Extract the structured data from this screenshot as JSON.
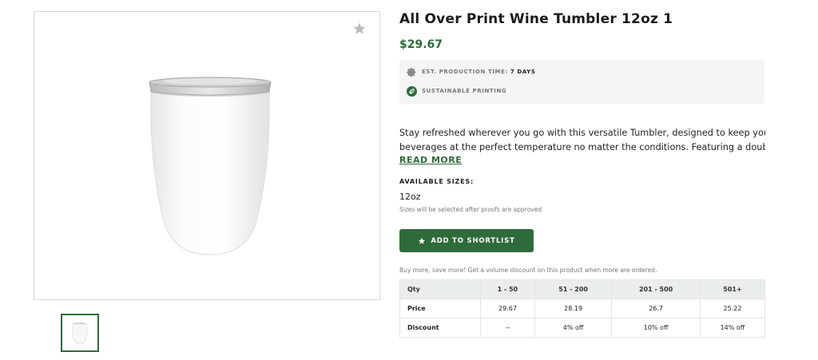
{
  "product": {
    "title": "All Over Print Wine Tumbler 12oz 1",
    "price": "$29.67",
    "specs": {
      "production_label": "EST. PRODUCTION TIME:",
      "production_value": "7 DAYS",
      "production_icon": "gear-icon",
      "sustainable_label": "SUSTAINABLE PRINTING",
      "sustainable_icon": "leaf-icon"
    },
    "description_line1": "Stay refreshed wherever you go with this versatile Tumbler, designed to keep your",
    "description_line2": "beverages at the perfect temperature no matter the conditions. Featuring a double-…",
    "read_more": "READ MORE"
  },
  "sizes": {
    "label": "AVAILABLE SIZES:",
    "value": "12oz",
    "note": "Sizes will be selected after proofs are approved"
  },
  "actions": {
    "shortlist_label": "ADD TO SHORTLIST",
    "shortlist_icon": "star-icon"
  },
  "gallery": {
    "favorite_icon": "star-icon"
  },
  "volume": {
    "note": "Buy more, save more! Get a volume discount on this product when more are ordered.",
    "headers": [
      "Qty",
      "1 - 50",
      "51 - 200",
      "201 - 500",
      "501+"
    ],
    "rows": [
      [
        "Price",
        "29.67",
        "28.19",
        "26.7",
        "25.22"
      ],
      [
        "Discount",
        "--",
        "4% off",
        "10% off",
        "14% off"
      ]
    ]
  },
  "colors": {
    "accent": "#2e6b3a",
    "table_header": "#eaeeea",
    "spec_bg": "#f5f5f5"
  }
}
